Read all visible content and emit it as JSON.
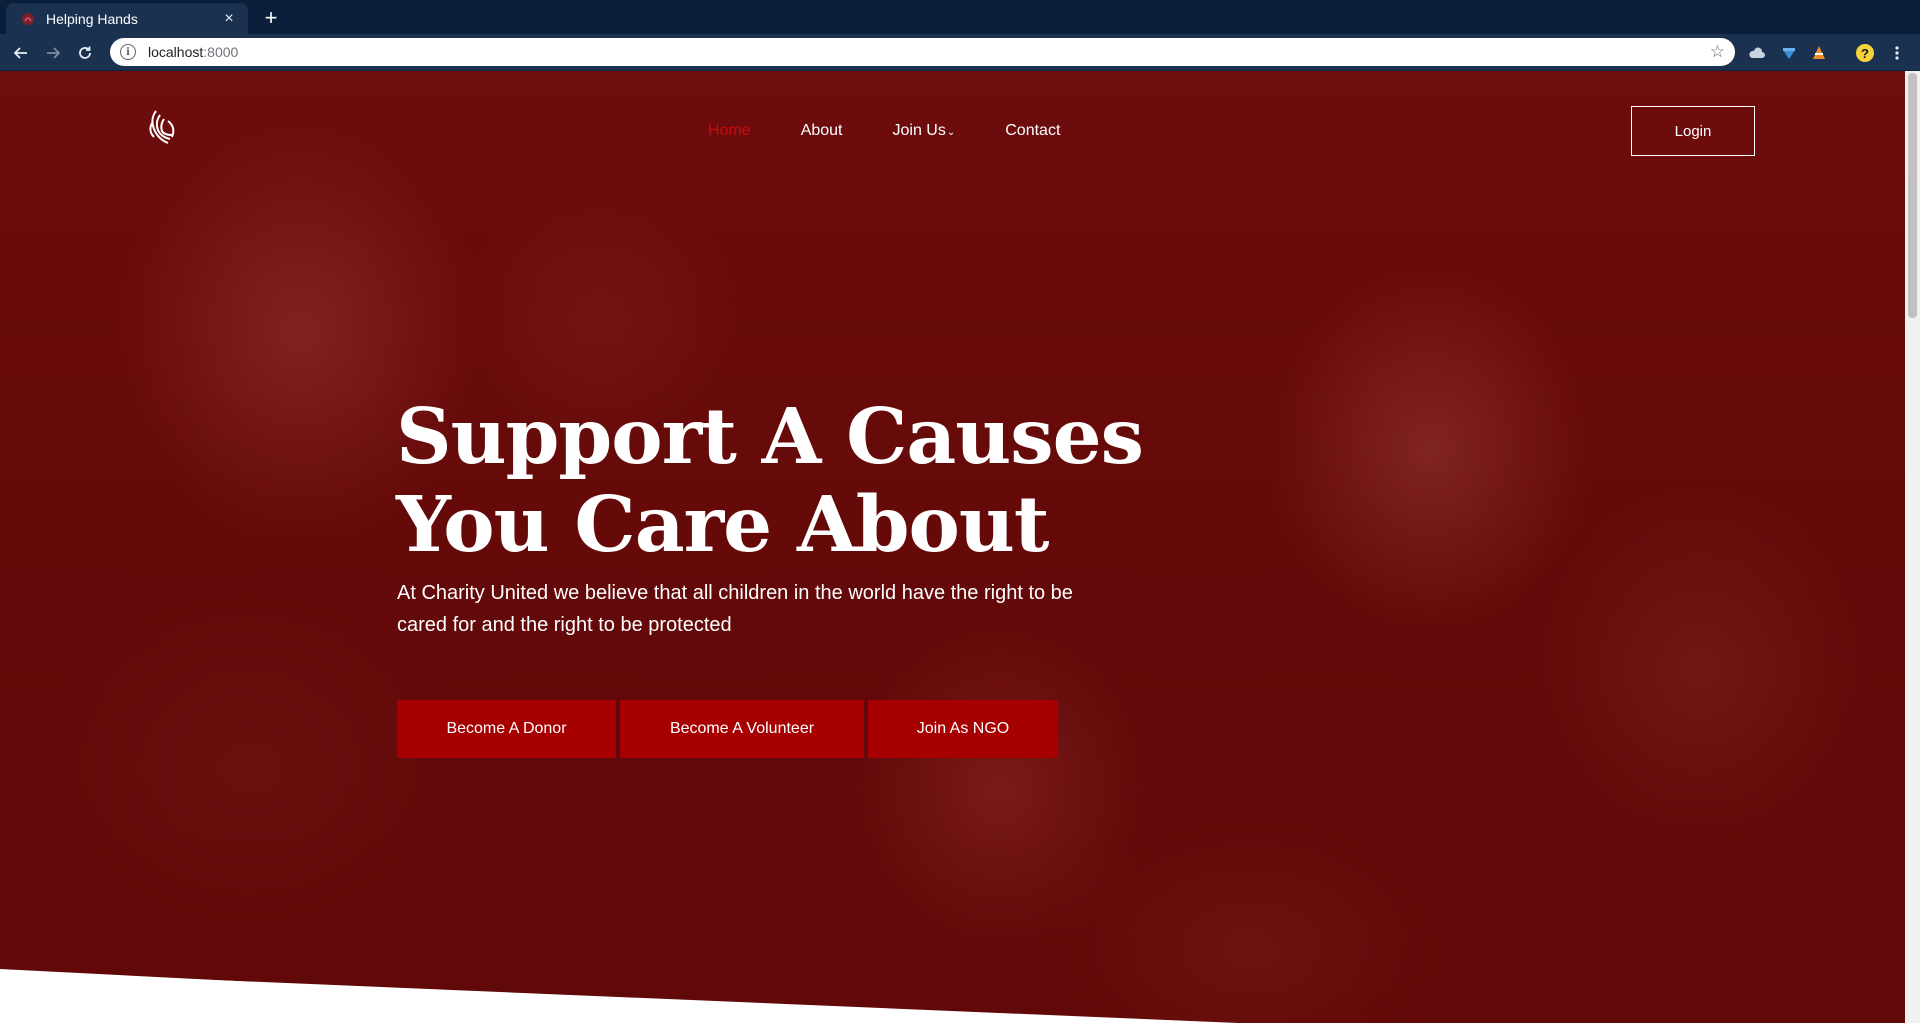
{
  "browser": {
    "tab_title": "Helping Hands",
    "tab_close": "×",
    "new_tab": "+",
    "url_host": "localhost",
    "url_port": ":8000"
  },
  "site": {
    "nav": {
      "home": "Home",
      "about": "About",
      "join": "Join Us",
      "join_caret": "⌄",
      "contact": "Contact"
    },
    "login": "Login",
    "hero": {
      "title_line1": "Support A Causes",
      "title_line2": "You Care About",
      "subtitle": "At Charity United we believe that all children in the world have the right to be cared for and the right to be protected"
    },
    "cta": {
      "donor": "Become A Donor",
      "volunteer": "Become A Volunteer",
      "ngo": "Join As NGO"
    }
  },
  "colors": {
    "accent": "#a60000",
    "active_nav": "#c80d0d",
    "overlay": "#6e0808"
  }
}
